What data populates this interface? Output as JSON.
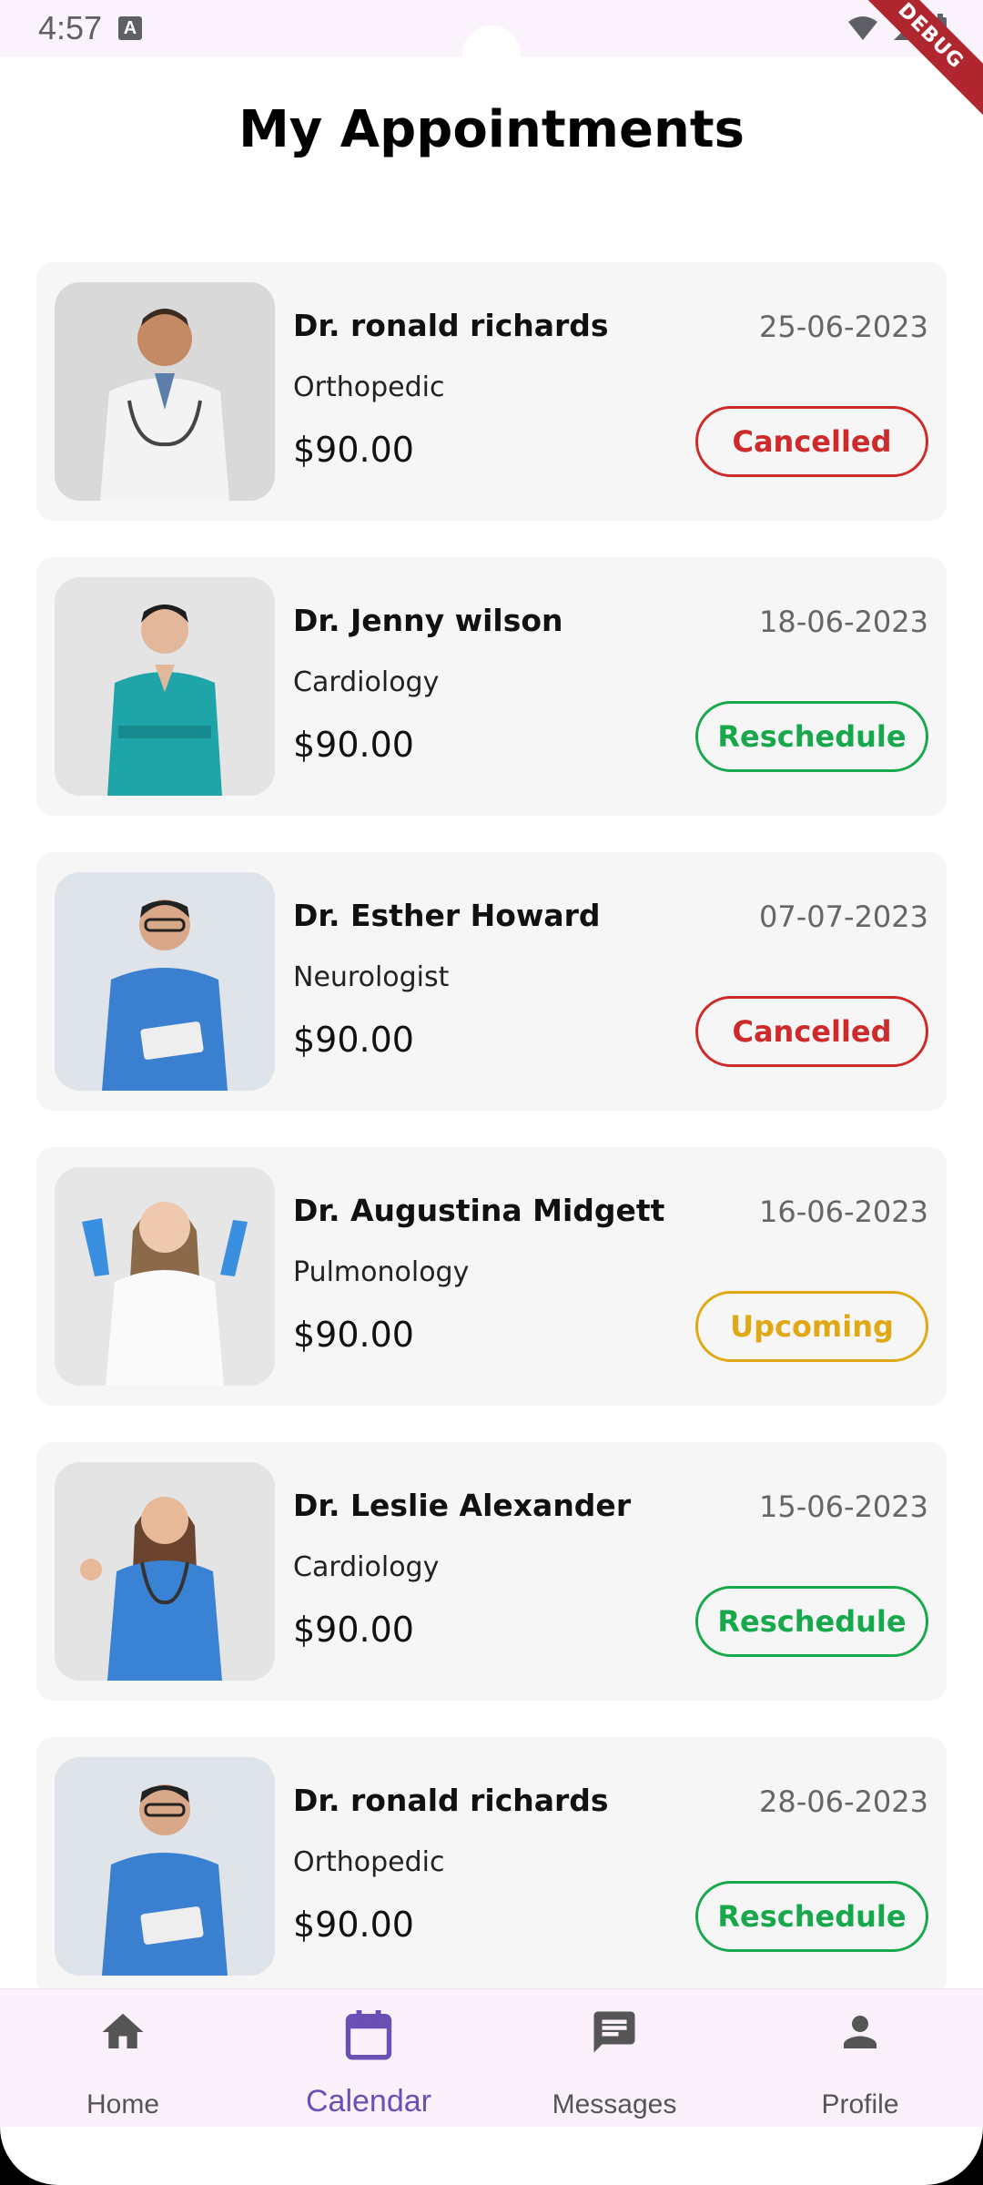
{
  "status_bar": {
    "time": "4:57",
    "notification_glyph": "A",
    "debug_label": "DEBUG"
  },
  "header": {
    "title": "My Appointments"
  },
  "appointments": [
    {
      "name": "Dr. ronald richards",
      "specialty": "Orthopedic",
      "price": "$90.00",
      "date": "25-06-2023",
      "status": "Cancelled",
      "status_color": "#cf2a2a"
    },
    {
      "name": "Dr. Jenny wilson",
      "specialty": "Cardiology",
      "price": "$90.00",
      "date": "18-06-2023",
      "status": "Reschedule",
      "status_color": "#17a84c"
    },
    {
      "name": "Dr. Esther Howard",
      "specialty": "Neurologist",
      "price": "$90.00",
      "date": "07-07-2023",
      "status": "Cancelled",
      "status_color": "#cf2a2a"
    },
    {
      "name": "Dr. Augustina Midgett",
      "specialty": "Pulmonology",
      "price": "$90.00",
      "date": "16-06-2023",
      "status": "Upcoming",
      "status_color": "#e0a814"
    },
    {
      "name": "Dr. Leslie Alexander",
      "specialty": "Cardiology",
      "price": "$90.00",
      "date": "15-06-2023",
      "status": "Reschedule",
      "status_color": "#17a84c"
    },
    {
      "name": "Dr. ronald richards",
      "specialty": "Orthopedic",
      "price": "$90.00",
      "date": "28-06-2023",
      "status": "Reschedule",
      "status_color": "#17a84c"
    }
  ],
  "bottom_nav": {
    "items": [
      {
        "label": "Home",
        "icon": "home-icon"
      },
      {
        "label": "Calendar",
        "icon": "calendar-icon",
        "active": true
      },
      {
        "label": "Messages",
        "icon": "messages-icon"
      },
      {
        "label": "Profile",
        "icon": "profile-icon"
      }
    ],
    "active_color": "#6a4fb5"
  }
}
